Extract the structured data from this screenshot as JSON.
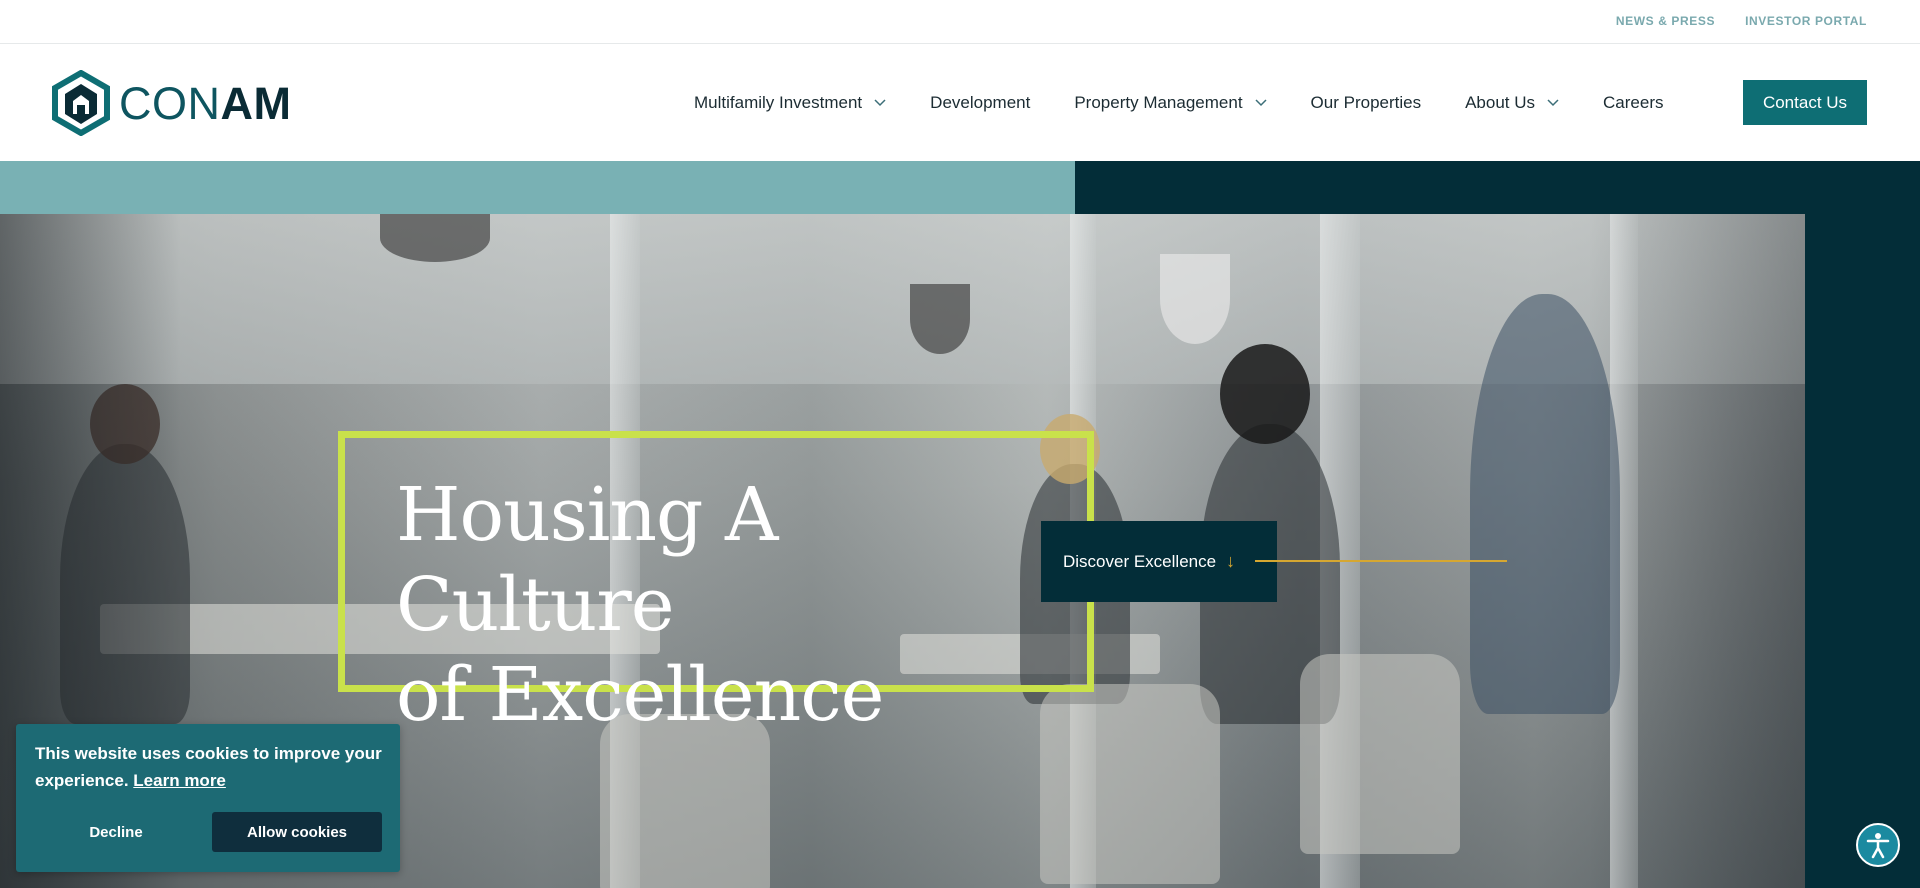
{
  "utility_bar": {
    "links": [
      {
        "label": "NEWS & PRESS"
      },
      {
        "label": "INVESTOR PORTAL"
      }
    ]
  },
  "header": {
    "logo": {
      "text_light": "CON",
      "text_bold": "AM"
    },
    "nav": [
      {
        "label": "Multifamily Investment",
        "has_dropdown": true
      },
      {
        "label": "Development",
        "has_dropdown": false
      },
      {
        "label": "Property Management",
        "has_dropdown": true
      },
      {
        "label": "Our Properties",
        "has_dropdown": false
      },
      {
        "label": "About Us",
        "has_dropdown": true
      },
      {
        "label": "Careers",
        "has_dropdown": false
      }
    ],
    "contact_label": "Contact Us"
  },
  "hero": {
    "headline_line1": "Housing A Culture",
    "headline_line2": "of Excellence",
    "discover_label": "Discover Excellence",
    "discover_arrow": "↓"
  },
  "cookie_banner": {
    "message": "This website uses cookies to improve your experience.",
    "learn_more": "Learn more",
    "decline_label": "Decline",
    "allow_label": "Allow cookies"
  },
  "colors": {
    "brand_dark": "#032d38",
    "brand_teal": "#0e6e74",
    "light_teal": "#79b1b4",
    "accent_lime": "#c9e14b",
    "accent_gold": "#d6a731",
    "cookie_bg": "#1d6a74"
  },
  "icons": {
    "logo": "hexagon-house-icon",
    "dropdown": "chevron-down-icon",
    "discover": "arrow-down-icon",
    "accessibility": "accessibility-person-icon"
  }
}
